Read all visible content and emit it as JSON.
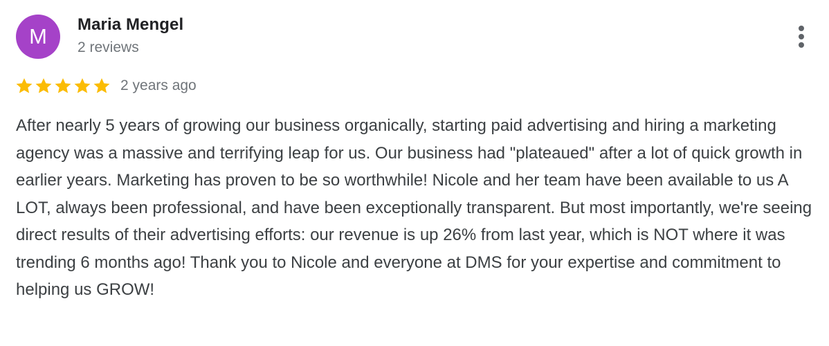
{
  "review": {
    "author": {
      "initial": "M",
      "name": "Maria Mengel",
      "review_count": "2 reviews",
      "avatar_color": "#a542c8"
    },
    "rating": {
      "stars": 5,
      "max_stars": 5,
      "star_color": "#fbbc04",
      "icon": "star-icon"
    },
    "date": "2 years ago",
    "text": "After nearly 5 years of growing our business organically, starting paid advertising and hiring a marketing agency was a massive and terrifying leap for us. Our business had \"plateaued\" after a lot of quick growth in earlier years. Marketing has proven to be so worthwhile! Nicole and her team have been available to us A LOT, always been professional, and have been exceptionally transparent. But most importantly, we're seeing direct results of their advertising efforts: our revenue is up 26% from last year, which is NOT where it was trending 6 months ago! Thank you to Nicole and everyone at DMS for your expertise and commitment to helping us GROW!",
    "menu_icon": "more-vert-icon"
  }
}
